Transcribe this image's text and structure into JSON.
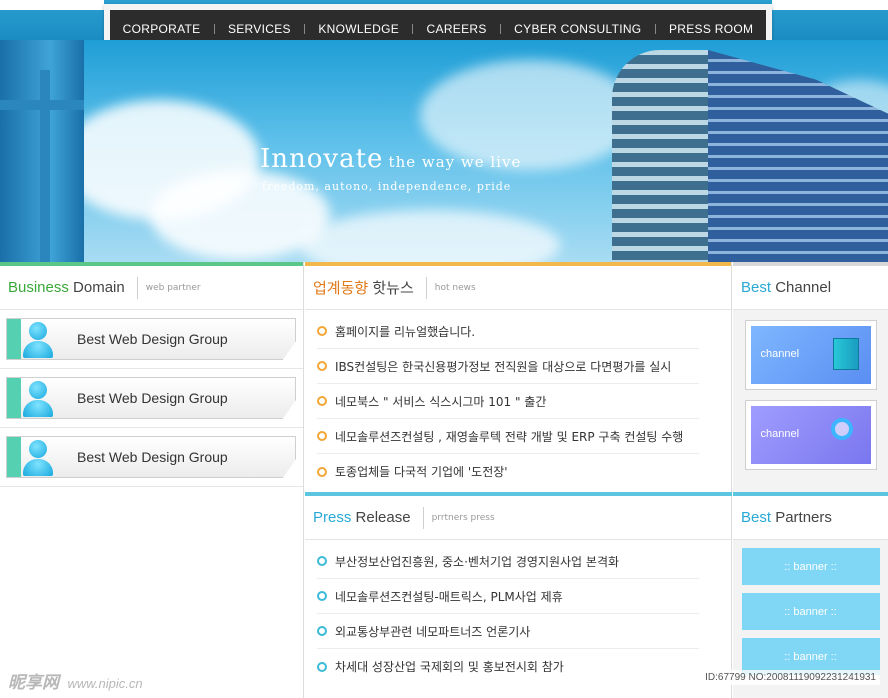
{
  "nav": {
    "items": [
      {
        "label": "CORPORATE"
      },
      {
        "label": "SERVICES"
      },
      {
        "label": "KNOWLEDGE"
      },
      {
        "label": "CAREERS"
      },
      {
        "label": "CYBER CONSULTING"
      },
      {
        "label": "PRESS ROOM"
      }
    ]
  },
  "hero": {
    "headline_big": "Innovate",
    "headline_small": "the way we live",
    "subline": "freedom, autono, independence, pride"
  },
  "business": {
    "title_accent": "Business",
    "title_rest": "Domain",
    "subtitle": "web partner",
    "items": [
      {
        "label": "Best Web Design Group"
      },
      {
        "label": "Best Web Design Group"
      },
      {
        "label": "Best Web Design Group"
      }
    ]
  },
  "hotnews": {
    "title_accent": "업계동향",
    "title_rest": "핫뉴스",
    "subtitle": "hot news",
    "items": [
      {
        "text": "홈페이지를 리뉴얼했습니다."
      },
      {
        "text": "IBS컨설팅은 한국신용평가정보 전직원을 대상으로 다면평가를 실시"
      },
      {
        "text": "네모북스 \" 서비스 식스시그마 101 \" 출간"
      },
      {
        "text": "네모솔루션즈컨설팅 , 재영솔루텍 전략 개발 및 ERP 구축 컨설팅 수행"
      },
      {
        "text": "토종업체들 다국적 기업에 '도전장'"
      }
    ]
  },
  "press": {
    "title_accent": "Press",
    "title_rest": "Release",
    "subtitle": "prrtners press",
    "items": [
      {
        "text": "부산정보산업진흥원, 중소·벤처기업 경영지원사업 본격화"
      },
      {
        "text": "네모솔루션즈컨설팅-매트릭스, PLM사업 제휴"
      },
      {
        "text": "외교통상부관련 네모파트너즈 언론기사"
      },
      {
        "text": "차세대 성장산업 국제회의 및 홍보전시회 참가"
      }
    ]
  },
  "channel": {
    "title_accent": "Best",
    "title_rest": "Channel",
    "items": [
      {
        "label": "channel",
        "icon": "server-cube-icon"
      },
      {
        "label": "channel",
        "icon": "magnifier-icon"
      }
    ]
  },
  "partners": {
    "title_accent": "Best",
    "title_rest": "Partners",
    "banners": [
      {
        "label": ":: banner ::"
      },
      {
        "label": ":: banner ::"
      },
      {
        "label": ":: banner ::"
      }
    ]
  },
  "watermark": {
    "logo": "昵享网",
    "url": "www.nipic.cn",
    "id_text": "ID:67799 NO:20081119092231241931"
  },
  "colors": {
    "accent_cyan": "#28a9d6",
    "accent_green": "#3aa83a",
    "accent_orange": "#e07a1a",
    "hot_bar": "#f2b84b",
    "press_bar": "#5cc6e0"
  }
}
